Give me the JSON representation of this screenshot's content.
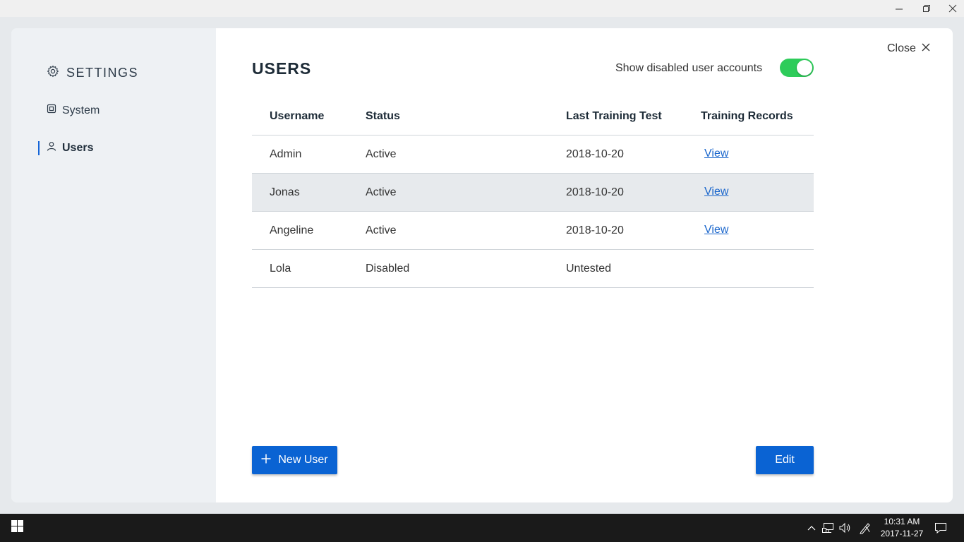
{
  "window": {
    "controls": [
      "minimize-icon",
      "restore-icon",
      "close-icon"
    ]
  },
  "sidebar": {
    "title": "SETTINGS",
    "title_icon": "gear-icon",
    "items": [
      {
        "label": "System",
        "icon": "system-icon",
        "active": false
      },
      {
        "label": "Users",
        "icon": "user-icon",
        "active": true
      }
    ]
  },
  "header": {
    "title": "USERS",
    "toggle_label": "Show disabled user accounts",
    "toggle_on": true,
    "close_label": "Close"
  },
  "table": {
    "columns": [
      "Username",
      "Status",
      "Last Training Test",
      "Training Records"
    ],
    "rows": [
      {
        "username": "Admin",
        "status": "Active",
        "last_test": "2018-10-20",
        "records": "View"
      },
      {
        "username": "Jonas",
        "status": "Active",
        "last_test": "2018-10-20",
        "records": "View"
      },
      {
        "username": "Angeline",
        "status": "Active",
        "last_test": "2018-10-20",
        "records": "View"
      },
      {
        "username": "Lola",
        "status": "Disabled",
        "last_test": "Untested",
        "records": ""
      }
    ]
  },
  "actions": {
    "new_user_label": "New User",
    "edit_label": "Edit"
  },
  "taskbar": {
    "time": "10:31 AM",
    "date": "2017-11-27"
  },
  "colors": {
    "accent": "#0a63d3",
    "toggle_on": "#2ecc5a",
    "sidebar_bg": "#eef1f4",
    "link": "#1a66cc"
  }
}
